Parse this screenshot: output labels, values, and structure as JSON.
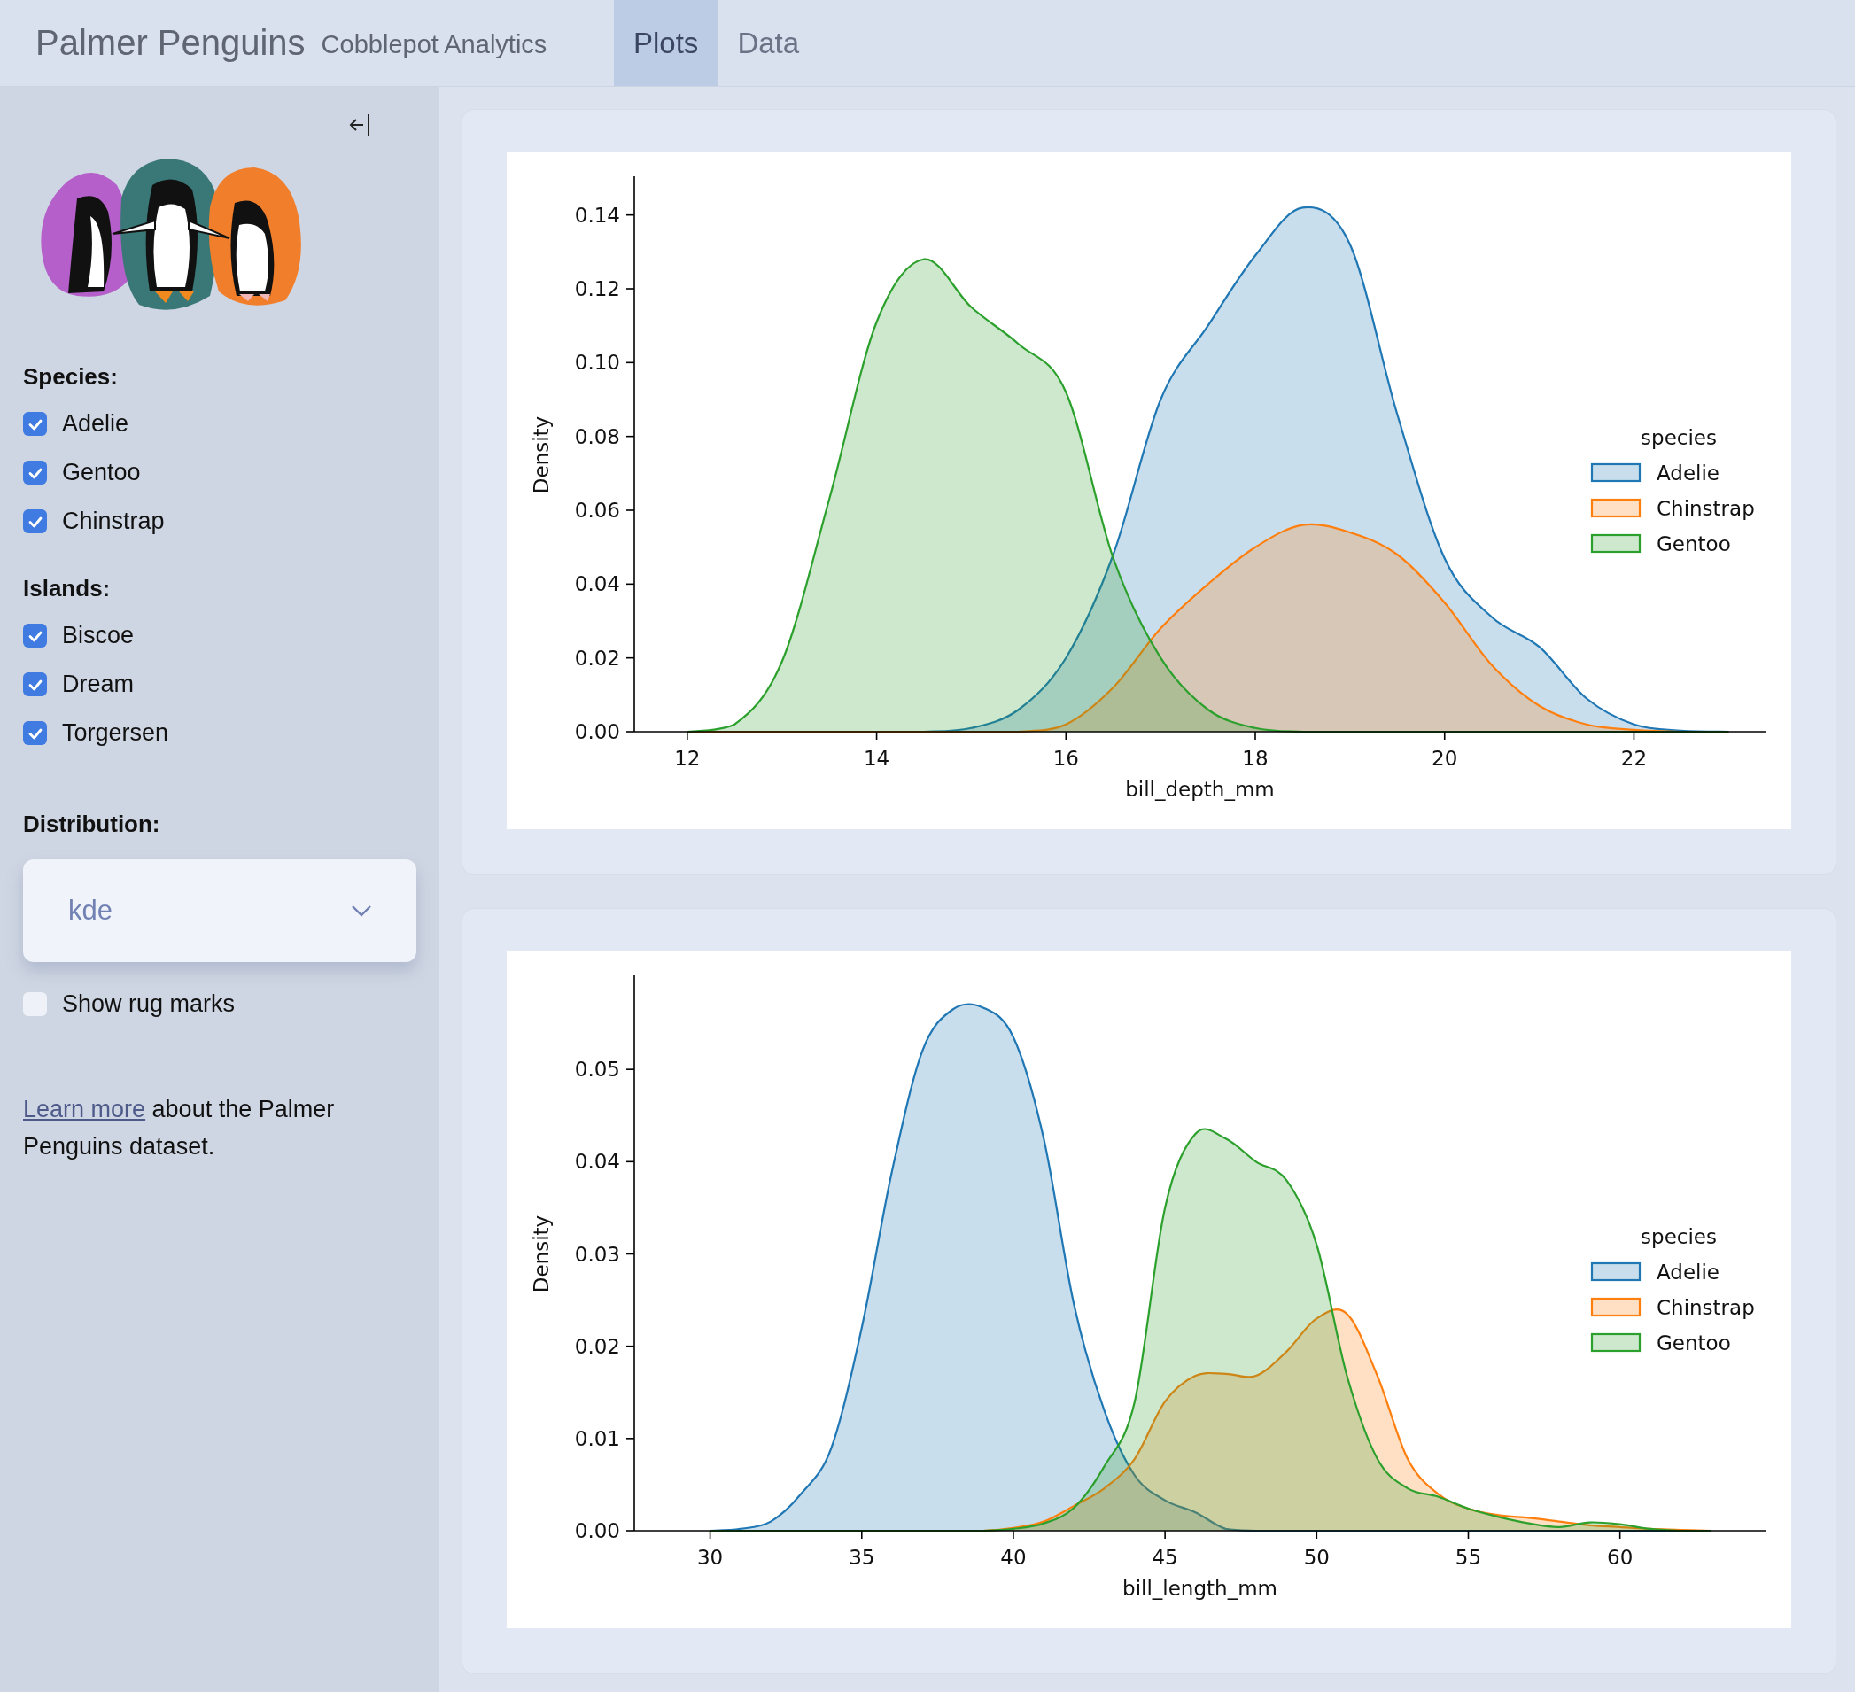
{
  "header": {
    "title": "Palmer Penguins",
    "subtitle": "Cobblepot Analytics"
  },
  "tabs": [
    {
      "label": "Plots",
      "selected": true
    },
    {
      "label": "Data",
      "selected": false
    }
  ],
  "sidebar": {
    "groups": [
      {
        "label": "Species:",
        "options": [
          {
            "label": "Adelie",
            "checked": true
          },
          {
            "label": "Gentoo",
            "checked": true
          },
          {
            "label": "Chinstrap",
            "checked": true
          }
        ]
      },
      {
        "label": "Islands:",
        "options": [
          {
            "label": "Biscoe",
            "checked": true
          },
          {
            "label": "Dream",
            "checked": true
          },
          {
            "label": "Torgersen",
            "checked": true
          }
        ]
      }
    ],
    "distribution": {
      "label": "Distribution:",
      "value": "kde"
    },
    "rug": {
      "label": "Show rug marks",
      "checked": false
    },
    "note": {
      "link": "Learn more",
      "text": " about the Palmer Penguins dataset."
    }
  },
  "panels": [
    {
      "chart_data": {
        "type": "area",
        "legend": {
          "title": "species"
        },
        "xlabel": "bill_depth_mm",
        "ylabel": "Density",
        "xlim": [
          11.44,
          23.39
        ],
        "ylim": [
          0,
          0.15
        ],
        "xticks": [
          12,
          14,
          16,
          18,
          20,
          22
        ],
        "yticks": [
          {
            "value": 0,
            "label": "0.00"
          },
          {
            "value": 0.02,
            "label": "0.02"
          },
          {
            "value": 0.04,
            "label": "0.04"
          },
          {
            "value": 0.06,
            "label": "0.06"
          },
          {
            "value": 0.08,
            "label": "0.08"
          },
          {
            "value": 0.1,
            "label": "0.10"
          },
          {
            "value": 0.12,
            "label": "0.12"
          },
          {
            "value": 0.14,
            "label": "0.14"
          }
        ],
        "x": [
          12,
          12.5,
          13,
          13.5,
          14,
          14.5,
          15,
          15.5,
          16,
          16.5,
          17,
          17.5,
          18,
          18.5,
          19,
          19.5,
          20,
          20.5,
          21,
          21.5,
          22,
          22.5,
          23
        ],
        "series": [
          {
            "name": "Adelie",
            "color": "#1f77b4",
            "values": [
              0,
              0,
              0,
              0,
              0,
              0,
              0.001,
              0.006,
              0.02,
              0.048,
              0.09,
              0.11,
              0.129,
              0.142,
              0.132,
              0.086,
              0.047,
              0.031,
              0.023,
              0.009,
              0.002,
              0.0003,
              0
            ]
          },
          {
            "name": "Chinstrap",
            "color": "#ff7f0e",
            "values": [
              0,
              0,
              0,
              0,
              0,
              0,
              0,
              0,
              0.002,
              0.012,
              0.028,
              0.04,
              0.05,
              0.056,
              0.054,
              0.048,
              0.035,
              0.018,
              0.007,
              0.002,
              0.0005,
              0,
              0
            ]
          },
          {
            "name": "Gentoo",
            "color": "#2ca02c",
            "values": [
              0,
              0.002,
              0.019,
              0.063,
              0.111,
              0.128,
              0.115,
              0.105,
              0.092,
              0.047,
              0.02,
              0.006,
              0.001,
              0,
              0,
              0,
              0,
              0,
              0,
              0,
              0,
              0,
              0
            ]
          }
        ]
      }
    },
    {
      "chart_data": {
        "type": "area",
        "legend": {
          "title": "species"
        },
        "xlabel": "bill_length_mm",
        "ylabel": "Density",
        "xlim": [
          27.5,
          64.8
        ],
        "ylim": [
          0,
          0.06
        ],
        "xticks": [
          30,
          35,
          40,
          45,
          50,
          55,
          60
        ],
        "yticks": [
          {
            "value": 0,
            "label": "0.00"
          },
          {
            "value": 0.01,
            "label": "0.01"
          },
          {
            "value": 0.02,
            "label": "0.02"
          },
          {
            "value": 0.03,
            "label": "0.03"
          },
          {
            "value": 0.04,
            "label": "0.04"
          },
          {
            "value": 0.05,
            "label": "0.05"
          }
        ],
        "x": [
          30,
          31,
          32,
          33,
          34,
          35,
          36,
          37,
          38,
          39,
          40,
          41,
          42,
          43,
          44,
          45,
          46,
          47,
          48,
          49,
          50,
          51,
          52,
          53,
          54,
          55,
          56,
          57,
          58,
          59,
          60,
          61,
          62,
          63
        ],
        "series": [
          {
            "name": "Adelie",
            "color": "#1f77b4",
            "values": [
              0,
              0.0002,
              0.001,
              0.004,
              0.009,
              0.022,
              0.039,
              0.052,
              0.0565,
              0.0567,
              0.0535,
              0.0425,
              0.0245,
              0.013,
              0.006,
              0.0033,
              0.002,
              0.0002,
              0,
              0,
              0,
              0,
              0,
              0,
              0,
              0,
              0,
              0,
              0,
              0,
              0,
              0,
              0,
              0
            ]
          },
          {
            "name": "Chinstrap",
            "color": "#ff7f0e",
            "values": [
              0,
              0,
              0,
              0,
              0,
              0,
              0,
              0,
              0,
              0,
              0.0003,
              0.001,
              0.0027,
              0.0046,
              0.0078,
              0.014,
              0.0168,
              0.017,
              0.0168,
              0.0194,
              0.023,
              0.0235,
              0.0168,
              0.0078,
              0.004,
              0.0024,
              0.0017,
              0.0014,
              0.001,
              0.0006,
              0.0004,
              0.0002,
              0.0001,
              0
            ]
          },
          {
            "name": "Gentoo",
            "color": "#2ca02c",
            "values": [
              0,
              0,
              0,
              0,
              0,
              0,
              0,
              0,
              0,
              0,
              0.0002,
              0.0008,
              0.0025,
              0.007,
              0.014,
              0.035,
              0.043,
              0.0425,
              0.04,
              0.038,
              0.031,
              0.0168,
              0.0078,
              0.0046,
              0.0037,
              0.0024,
              0.0015,
              0.0008,
              0.0004,
              0.0009,
              0.0007,
              0.0002,
              0,
              0
            ]
          }
        ]
      }
    }
  ]
}
